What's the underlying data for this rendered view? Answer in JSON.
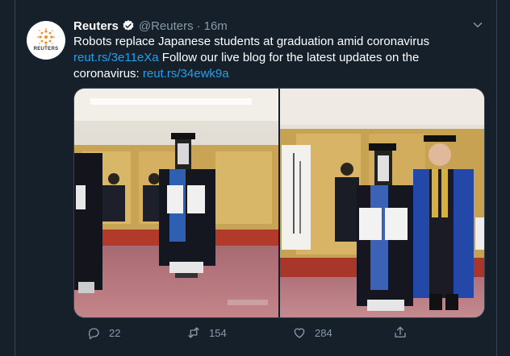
{
  "tweet": {
    "author_name": "Reuters",
    "handle": "@Reuters",
    "separator": "·",
    "time": "16m",
    "avatar_text": "REUTERS",
    "text_line1": "Robots replace Japanese students at graduation amid coronavirus",
    "link1": "reut.rs/3e11eXa",
    "text_mid": " Follow our live blog for the latest updates on the coronavirus: ",
    "link2": "reut.rs/34ewk9a"
  },
  "actions": {
    "replies": "22",
    "retweets": "154",
    "likes": "284"
  },
  "icons": {
    "verified": "verified-badge-icon",
    "menu": "chevron-down-icon",
    "reply": "reply-icon",
    "retweet": "retweet-icon",
    "like": "heart-icon",
    "share": "share-icon"
  },
  "colors": {
    "background": "#15202b",
    "link": "#1da1f2",
    "muted": "#8899a6",
    "border": "#38444d"
  }
}
